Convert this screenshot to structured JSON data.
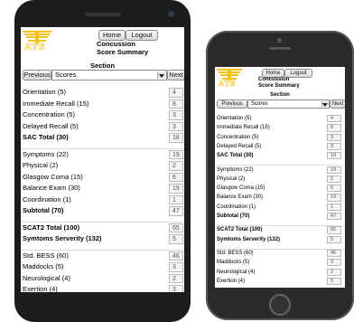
{
  "app": {
    "home_label": "Home",
    "logout_label": "Logout",
    "title_line1": "Concussion",
    "title_line2": "Score Summary",
    "section_label": "Section",
    "previous_label": "Previous",
    "next_label": "Next",
    "section_selected": "Scores",
    "logo_text": "ATS"
  },
  "rows": [
    {
      "label": "Orientation (5)",
      "value": "4"
    },
    {
      "label": "Immediate Recall (15)",
      "value": "8"
    },
    {
      "label": "Concentration (5)",
      "value": "3"
    },
    {
      "label": "Delayed Recall (5)",
      "value": "3"
    },
    {
      "label": "SAC Total (30)",
      "value": "18"
    },
    {
      "label": "Symptoms (22)",
      "value": "19"
    },
    {
      "label": "Physical (2)",
      "value": "2"
    },
    {
      "label": "Glasgow Coma (15)",
      "value": "6"
    },
    {
      "label": "Balance Exam (30)",
      "value": "19"
    },
    {
      "label": "Coordination (1)",
      "value": "1"
    },
    {
      "label": "Subtotal (70)",
      "value": "47"
    },
    {
      "label": "SCAT2 Total (100)",
      "value": "65"
    },
    {
      "label": "Symtoms Serverity (132)",
      "value": "5"
    },
    {
      "label": "Std. BESS (60)",
      "value": "46"
    },
    {
      "label": "Maddocks (5)",
      "value": "3"
    },
    {
      "label": "Neurological (4)",
      "value": "2"
    },
    {
      "label": "Exertion (4)",
      "value": "3"
    }
  ]
}
